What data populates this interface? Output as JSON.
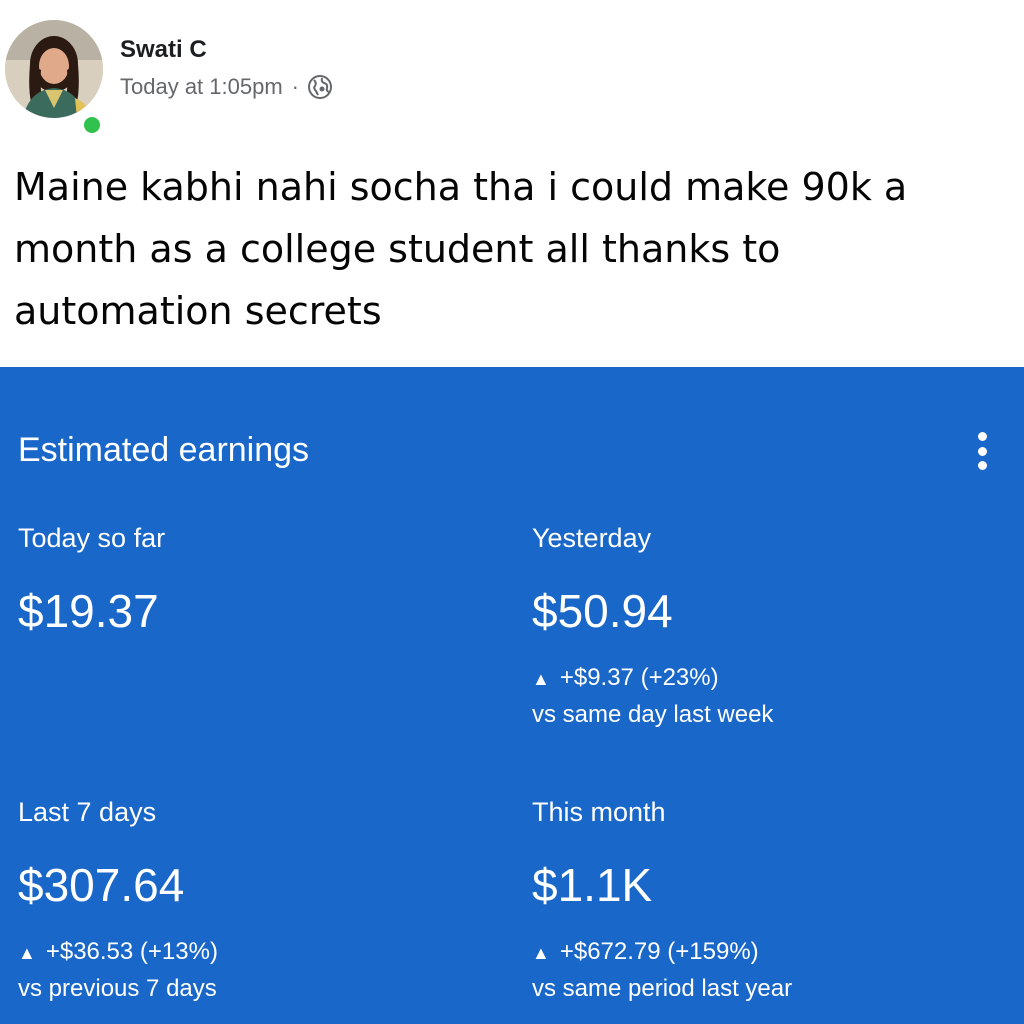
{
  "post": {
    "author": "Swati C",
    "time": "Today at 1:05pm",
    "separator": "·",
    "visibility_icon": "globe-icon",
    "online": true,
    "text_lines": [
      "Maine kabhi nahi socha tha i could make 90k a",
      "month as a college student all thanks to",
      "automation secrets"
    ]
  },
  "earnings_card": {
    "title": "Estimated earnings",
    "menu_icon": "more-vert-icon",
    "background_color": "#1967c9",
    "metrics": {
      "today": {
        "label": "Today so far",
        "value": "$19.37"
      },
      "yesterday": {
        "label": "Yesterday",
        "value": "$50.94",
        "delta": "+$9.37 (+23%)",
        "comparison": "vs same day last week"
      },
      "last7": {
        "label": "Last 7 days",
        "value": "$307.64",
        "delta": "+$36.53 (+13%)",
        "comparison": "vs previous 7 days"
      },
      "month": {
        "label": "This month",
        "value": "$1.1K",
        "delta": "+$672.79 (+159%)",
        "comparison": "vs same period last year"
      }
    },
    "up_arrow": "▲"
  }
}
